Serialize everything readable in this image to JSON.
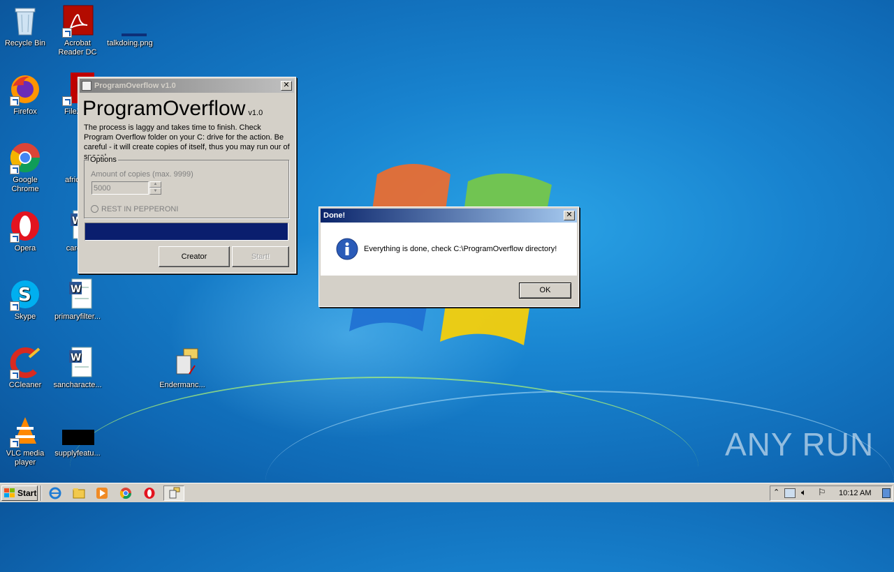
{
  "desktop": {
    "icons": [
      {
        "label": "Recycle Bin"
      },
      {
        "label": "Acrobat Reader DC"
      },
      {
        "label": "talkdoing.png"
      },
      {
        "label": "Firefox"
      },
      {
        "label": "FileZilla"
      },
      {
        "label": "Google Chrome"
      },
      {
        "label": "africam"
      },
      {
        "label": "Opera"
      },
      {
        "label": "carolin"
      },
      {
        "label": "Skype"
      },
      {
        "label": "primaryfilter..."
      },
      {
        "label": "CCleaner"
      },
      {
        "label": "sancharacte..."
      },
      {
        "label": "Endermanc..."
      },
      {
        "label": "VLC media player"
      },
      {
        "label": "supplyfeatu..."
      }
    ]
  },
  "program_window": {
    "title": "ProgramOverflow v1.0",
    "heading": "ProgramOverflow",
    "version": "v1.0",
    "description": "The process is laggy and takes time to finish. Check Program Overflow folder on your C: drive for the action. Be careful - it will create copies of itself, thus you may run our of space!",
    "options_label": "Options",
    "copies_label": "Amount of copies (max. 9999)",
    "copies_value": "5000",
    "radio_label": "REST IN PEPPERONI",
    "progress_fraction": 1.0,
    "creator_button": "Creator",
    "start_button": "Start!"
  },
  "done_dialog": {
    "title": "Done!",
    "message": "Everything is done, check C:\\ProgramOverflow directory!",
    "ok_button": "OK"
  },
  "taskbar": {
    "start_label": "Start",
    "clock": "10:12 AM",
    "pinned": [
      "internet-explorer-icon",
      "explorer-folder-icon",
      "media-player-icon",
      "chrome-icon",
      "opera-icon",
      "programoverflow-task-icon"
    ]
  },
  "watermark": "ANY RUN",
  "colors": {
    "desktop_blue": "#1883cf",
    "title_active": "#0a246a",
    "progress_fill": "#0a1e6e"
  }
}
